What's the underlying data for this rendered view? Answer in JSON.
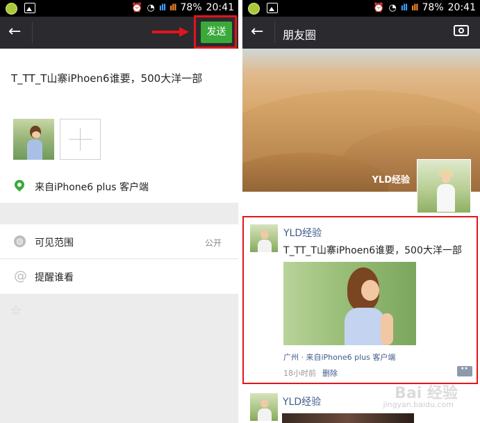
{
  "left": {
    "status": {
      "battery": "78%",
      "time": "20:41"
    },
    "toolbar": {
      "send_label": "发送"
    },
    "compose": {
      "text": "T_TT_T山寨iPhoen6谁要，500大洋一部",
      "location": "来自iPhone6 plus 客户端"
    },
    "settings": {
      "visibility_label": "可见范围",
      "visibility_value": "公开",
      "mention_label": "提醒谁看"
    }
  },
  "right": {
    "status": {
      "battery": "78%",
      "time": "20:41"
    },
    "title": "朋友圈",
    "cover_name": "YLD经验",
    "post": {
      "author": "YLD经验",
      "text": "T_TT_T山寨iPhoen6谁要，500大洋一部",
      "location": "广州 · 来自iPhone6 plus 客户端",
      "time": "18小时前",
      "delete": "删除"
    },
    "post2": {
      "author": "YLD经验"
    }
  },
  "watermark": {
    "brand": "Bai 经验",
    "url": "jingyan.baidu.com"
  },
  "colors": {
    "accent_green": "#3aa93a",
    "highlight_red": "#e2141a",
    "topbar": "#2b2b2f",
    "link_blue": "#3f5b8c"
  }
}
